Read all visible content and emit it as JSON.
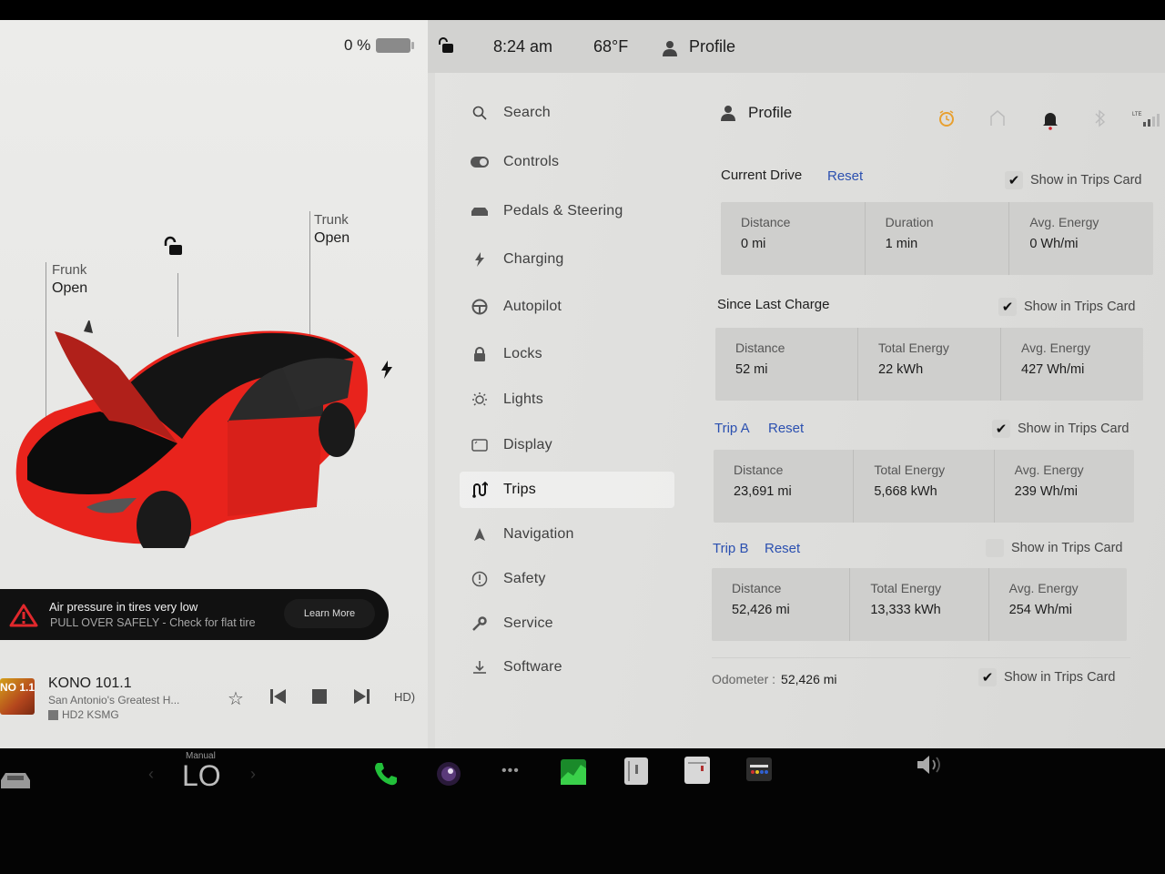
{
  "status": {
    "battery_percent": "0 %",
    "time": "8:24 am",
    "temperature": "68°F",
    "profile": "Profile"
  },
  "car": {
    "frunk_label": "Frunk",
    "frunk_state": "Open",
    "trunk_label": "Trunk",
    "trunk_state": "Open",
    "color": "#e8231c"
  },
  "alert": {
    "title": "Air pressure in tires very low",
    "subtitle": "PULL OVER SAFELY - Check for flat tire",
    "action": "Learn More",
    "icon": "warning-triangle-icon",
    "color": "#e0282c"
  },
  "media": {
    "logo_text": "NO 1.1",
    "station": "KONO 101.1",
    "description": "San Antonio's Greatest H...",
    "hd_channel": "HD2 KSMG"
  },
  "nav": {
    "items": [
      {
        "label": "Search",
        "icon": "search-icon"
      },
      {
        "label": "Controls",
        "icon": "toggle-icon"
      },
      {
        "label": "Pedals & Steering",
        "icon": "car-icon"
      },
      {
        "label": "Charging",
        "icon": "bolt-icon"
      },
      {
        "label": "Autopilot",
        "icon": "steering-wheel-icon"
      },
      {
        "label": "Locks",
        "icon": "lock-icon"
      },
      {
        "label": "Lights",
        "icon": "light-icon"
      },
      {
        "label": "Display",
        "icon": "display-icon"
      },
      {
        "label": "Trips",
        "icon": "trips-icon",
        "active": true
      },
      {
        "label": "Navigation",
        "icon": "navigation-icon"
      },
      {
        "label": "Safety",
        "icon": "safety-icon"
      },
      {
        "label": "Service",
        "icon": "wrench-icon"
      },
      {
        "label": "Software",
        "icon": "download-icon"
      }
    ]
  },
  "content": {
    "profile": "Profile",
    "show_in_trips_card": "Show in Trips Card",
    "reset": "Reset",
    "current_drive": {
      "title": "Current Drive",
      "show_checked": true,
      "stats": [
        {
          "label": "Distance",
          "value": "0 mi"
        },
        {
          "label": "Duration",
          "value": "1 min"
        },
        {
          "label": "Avg. Energy",
          "value": "0 Wh/mi"
        }
      ]
    },
    "since_last_charge": {
      "title": "Since Last Charge",
      "show_checked": true,
      "stats": [
        {
          "label": "Distance",
          "value": "52 mi"
        },
        {
          "label": "Total Energy",
          "value": "22 kWh"
        },
        {
          "label": "Avg. Energy",
          "value": "427 Wh/mi"
        }
      ]
    },
    "trip_a": {
      "title": "Trip A",
      "show_checked": true,
      "stats": [
        {
          "label": "Distance",
          "value": "23,691 mi"
        },
        {
          "label": "Total Energy",
          "value": "5,668 kWh"
        },
        {
          "label": "Avg. Energy",
          "value": "239 Wh/mi"
        }
      ]
    },
    "trip_b": {
      "title": "Trip B",
      "show_checked": false,
      "stats": [
        {
          "label": "Distance",
          "value": "52,426 mi"
        },
        {
          "label": "Total Energy",
          "value": "13,333 kWh"
        },
        {
          "label": "Avg. Energy",
          "value": "254 Wh/mi"
        }
      ]
    },
    "odometer": {
      "label": "Odometer :",
      "value": "52,426 mi",
      "show_checked": true
    }
  },
  "dock": {
    "climate_mode": "Manual",
    "climate_temp": "LO",
    "prev_arrow": "‹",
    "next_arrow": "›"
  },
  "colors": {
    "link": "#2b50b0",
    "alarm": "#e8a030",
    "phone": "#22c03a",
    "notification_dot": "#d0202a"
  }
}
